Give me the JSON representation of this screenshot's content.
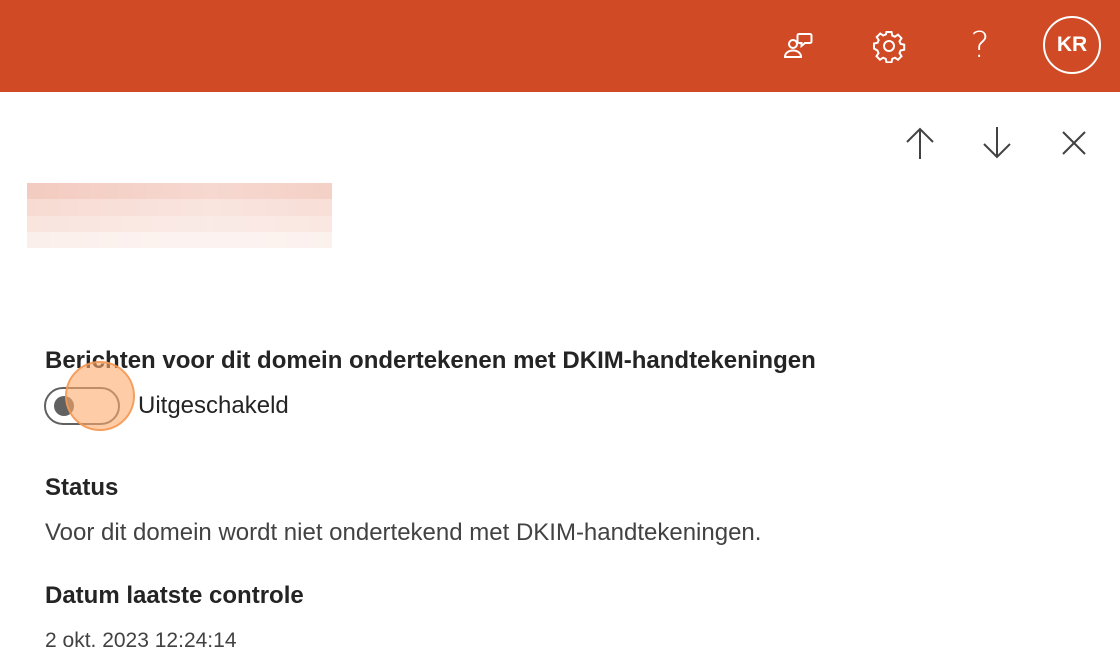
{
  "colors": {
    "topbar": "#d04a26",
    "text": "#242424",
    "muted_text": "#424242",
    "toggle_off": "#616161",
    "click_highlight": "#ffaa6e"
  },
  "topbar": {
    "icons": [
      "feedback-icon",
      "gear-icon",
      "help-icon"
    ],
    "help_glyph": "?",
    "avatar_initials": "KR"
  },
  "panel_nav": {
    "icons": [
      "arrow-up-icon",
      "arrow-down-icon",
      "close-icon"
    ]
  },
  "dkim": {
    "label": "Berichten voor dit domein ondertekenen met DKIM-handtekeningen",
    "toggle_state": "Uitgeschakeld",
    "enabled": false
  },
  "status": {
    "label": "Status",
    "value": "Voor dit domein wordt niet ondertekend met DKIM-handtekeningen."
  },
  "last_check": {
    "label": "Datum laatste controle",
    "value": "2 okt. 2023 12:24:14"
  }
}
